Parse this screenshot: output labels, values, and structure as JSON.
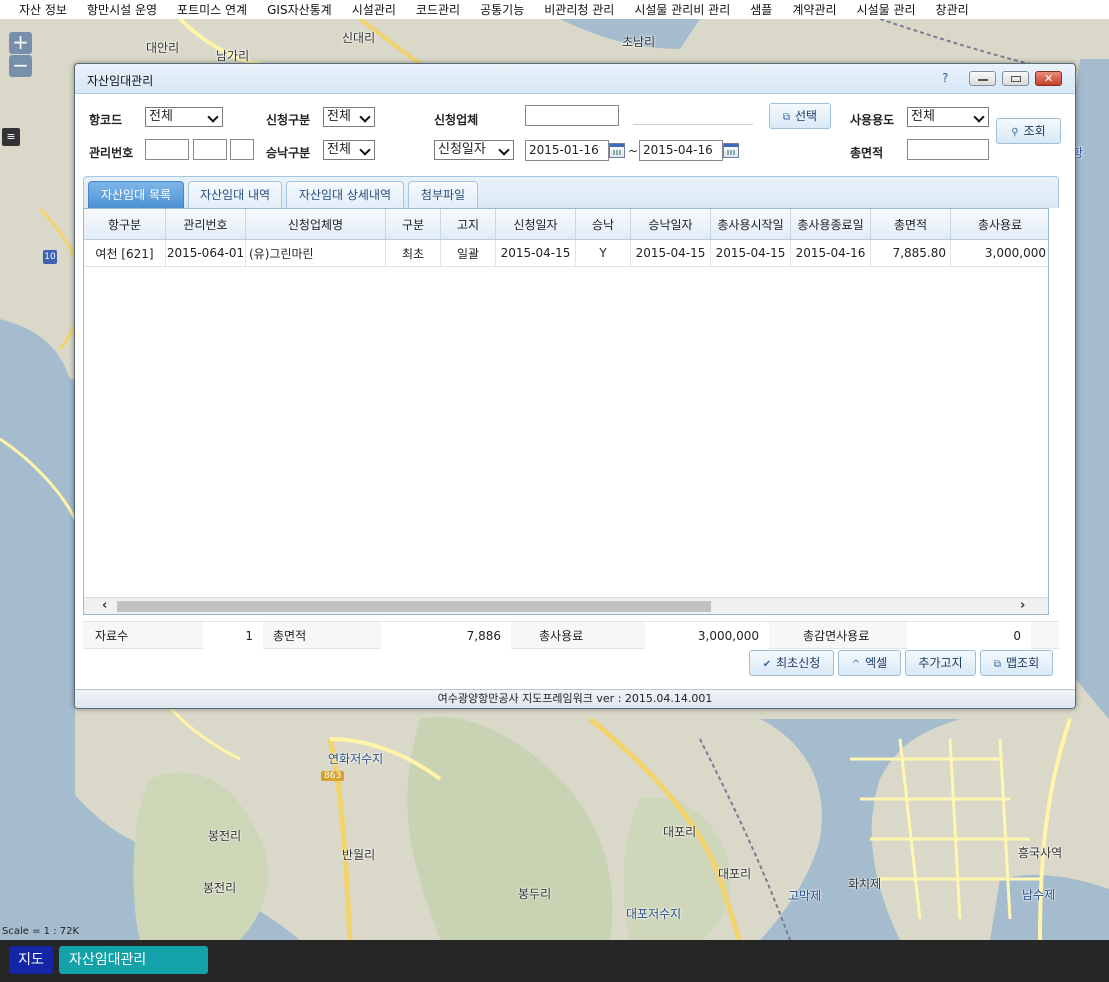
{
  "topmenu": [
    "자산 정보",
    "항만시설 운영",
    "포트미스 연계",
    "GIS자산통계",
    "시설관리",
    "코드관리",
    "공통기능",
    "비관리청 관리",
    "시설물 관리비 관리",
    "샘플",
    "계약관리",
    "시설물 관리",
    "창관리"
  ],
  "map": {
    "labels": [
      "대안리",
      "남가리",
      "신대리",
      "초남리",
      "연화저수지",
      "봉전리",
      "반월리",
      "봉전리",
      "봉두리",
      "대포리",
      "대포리",
      "고막제",
      "화치제",
      "흥국사역",
      "남수제",
      "대포저수지",
      "항"
    ],
    "road_badge": "863",
    "route_shield": "10",
    "zoom_in": "+",
    "zoom_out": "−",
    "scale": "Scale = 1 : 72K"
  },
  "window": {
    "title": "자산임대관리",
    "help": "?",
    "close": "✕"
  },
  "form": {
    "port_code_label": "항코드",
    "port_code_value": "전체",
    "req_type_label": "신청구분",
    "req_type_value": "전체",
    "company_label": "신청업체",
    "company_value": "",
    "select_button": "선택",
    "usage_label": "사용용도",
    "usage_value": "전체",
    "search_button": "조회",
    "mgmt_no_label": "관리번호",
    "approve_type_label": "승낙구분",
    "approve_type_value": "전체",
    "date_type_value": "신청일자",
    "date_from": "2015-01-16",
    "date_sep": "~",
    "date_to": "2015-04-16",
    "total_area_label": "총면적",
    "total_area_value": ""
  },
  "tabs": [
    "자산임대 목록",
    "자산임대 내역",
    "자산임대 상세내역",
    "첨부파일"
  ],
  "grid": {
    "columns": [
      "항구분",
      "관리번호",
      "신청업체명",
      "구분",
      "고지",
      "신청일자",
      "승낙",
      "승낙일자",
      "총사용시작일",
      "총사용종료일",
      "총면적",
      "총사용료"
    ],
    "rows": [
      [
        "여천 [621]",
        "2015-064-01",
        "(유)그린마린",
        "최초",
        "일괄",
        "2015-04-15",
        "Y",
        "2015-04-15",
        "2015-04-15",
        "2015-04-16",
        "7,885.80",
        "3,000,000"
      ]
    ]
  },
  "summary": {
    "count_label": "자료수",
    "count_value": "1",
    "area_label": "총면적",
    "area_value": "7,886",
    "fee_label": "총사용료",
    "fee_value": "3,000,000",
    "reduced_label": "총감면사용료",
    "reduced_value": "0"
  },
  "actions": {
    "first_request": "최초신청",
    "excel": "엑셀",
    "add_notice": "추가고지",
    "map_search": "맵조회"
  },
  "status_bar": "여수광양항만공사 지도프레임워크 ver : 2015.04.14.001",
  "taskbar": {
    "map": "지도",
    "window": "자산임대관리"
  }
}
